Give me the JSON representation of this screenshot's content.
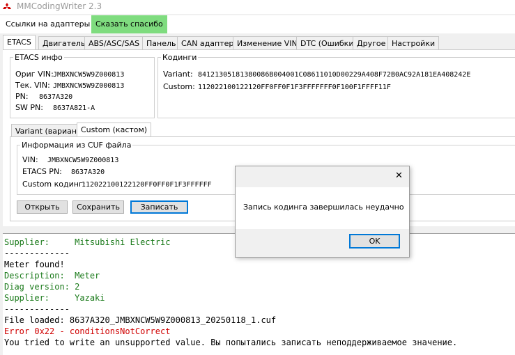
{
  "app": {
    "title": "MMCodingWriter 2.3"
  },
  "menu": {
    "adapters_label": "Ссылки на адаптеры",
    "thanks_label": "Сказать спасибо"
  },
  "tabs": [
    {
      "label": "ETACS"
    },
    {
      "label": "Двигатель"
    },
    {
      "label": "ABS/ASC/SAS"
    },
    {
      "label": "Панель"
    },
    {
      "label": "CAN адаптер"
    },
    {
      "label": "Изменение VIN"
    },
    {
      "label": "DTC (Ошибки)"
    },
    {
      "label": "Другое"
    },
    {
      "label": "Настройки"
    }
  ],
  "etacs_info": {
    "legend": "ETACS инфо",
    "orig_vin_label": "Ориг VIN:",
    "orig_vin": "JMBXNCW5W9Z000813",
    "cur_vin_label": "Тек. VIN:",
    "cur_vin": "JMBXNCW5W9Z000813",
    "pn_label": "PN:",
    "pn": "8637A320",
    "swpn_label": "SW PN:",
    "swpn": "8637A821-A"
  },
  "codings": {
    "legend": "Кодинги",
    "variant_label": "Variant:",
    "variant": "84121305181380086B004001C08611010D00229A408F72B0AC92A181EA408242E",
    "custom_label": "Custom:",
    "custom": "112022100122120FF0FF0F1F3FFFFFFF0F100F1FFFF11F"
  },
  "subtabs": [
    {
      "label": "Variant (вариант)"
    },
    {
      "label": "Custom (кастом)"
    }
  ],
  "cuf": {
    "legend": "Информация из CUF файла",
    "vin_label": "VIN:",
    "vin": "JMBXNCW5W9Z000813",
    "pn_label": "ETACS PN:",
    "pn": "8637A320",
    "custom_label": "Custom кодинг:",
    "custom": "112022100122120FF0FF0F1F3FFFFFF"
  },
  "buttons": {
    "open": "Открыть",
    "save": "Сохранить",
    "write": "Записать"
  },
  "console": [
    {
      "text": "Supplier:     Mitsubishi Electric",
      "color": "green"
    },
    {
      "text": "-------------",
      "color": "black"
    },
    {
      "text": "Meter found!",
      "color": "black"
    },
    {
      "text": "Description:  Meter",
      "color": "green"
    },
    {
      "text": "Diag version: 2",
      "color": "green"
    },
    {
      "text": "Supplier:     Yazaki",
      "color": "green"
    },
    {
      "text": "-------------",
      "color": "black"
    },
    {
      "text": "File loaded: 8637A320_JMBXNCW5W9Z000813_20250118_1.cuf",
      "color": "black"
    },
    {
      "text": "Error 0x22 - conditionsNotCorrect",
      "color": "red"
    },
    {
      "text": "You tried to write an unsupported value. Вы попытались записать неподдерживаемое значение.",
      "color": "black"
    }
  ],
  "dialog": {
    "message": "Запись кодинга завершилась неудачно",
    "ok_label": "OK",
    "close_glyph": "✕"
  },
  "colors": {
    "accent_green": "#7fdc7f",
    "console_green": "#1a7a1a",
    "console_red": "#d00000",
    "focus_blue": "#0078d7"
  }
}
